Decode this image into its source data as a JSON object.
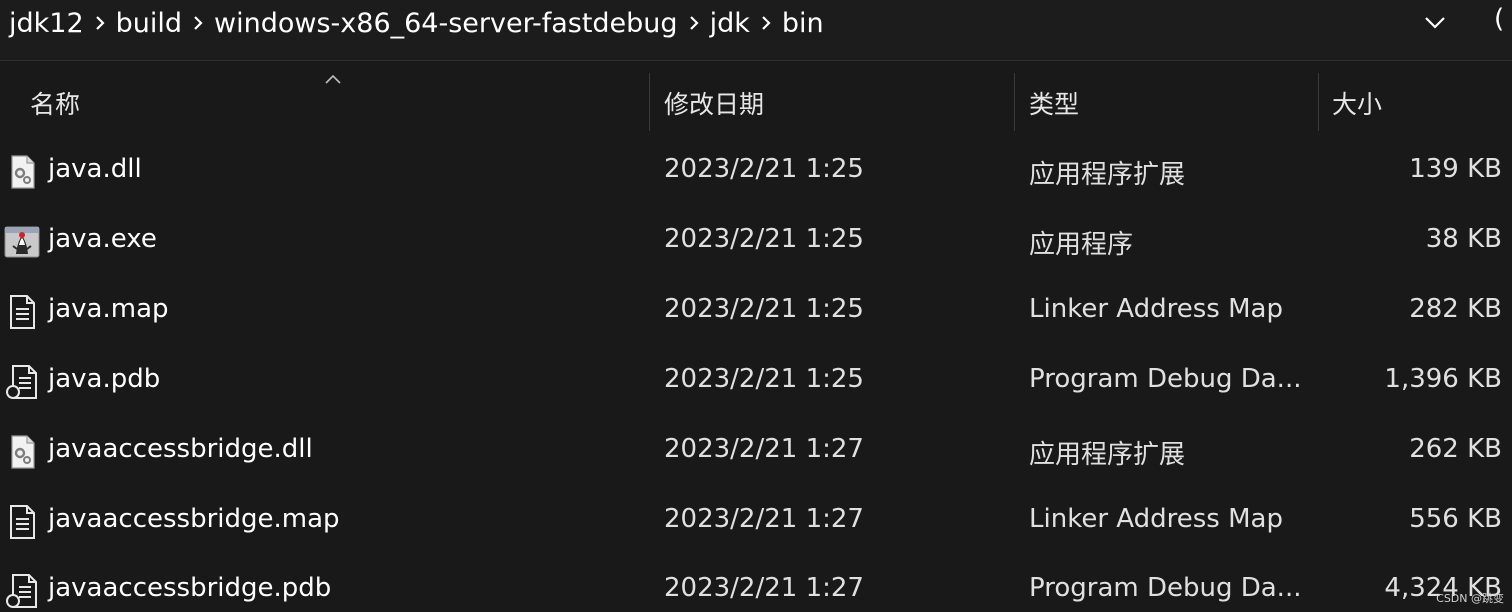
{
  "breadcrumb": {
    "items": [
      "jdk12",
      "build",
      "windows-x86_64-server-fastdebug",
      "jdk",
      "bin"
    ]
  },
  "icons": {
    "separator": "chevron-right-icon",
    "dropdown": "chevron-down-icon",
    "sort": "sort-ascending-icon"
  },
  "columns": {
    "name": "名称",
    "modified": "修改日期",
    "type": "类型",
    "size": "大小"
  },
  "files": [
    {
      "name": "java.dll",
      "modified": "2023/2/21 1:25",
      "type": "应用程序扩展",
      "size": "139 KB",
      "icon": "dll-file-icon"
    },
    {
      "name": "java.exe",
      "modified": "2023/2/21 1:25",
      "type": "应用程序",
      "size": "38 KB",
      "icon": "java-exe-icon"
    },
    {
      "name": "java.map",
      "modified": "2023/2/21 1:25",
      "type": "Linker Address Map",
      "size": "282 KB",
      "icon": "text-file-icon"
    },
    {
      "name": "java.pdb",
      "modified": "2023/2/21 1:25",
      "type": "Program Debug Da...",
      "size": "1,396 KB",
      "icon": "pdb-file-icon"
    },
    {
      "name": "javaaccessbridge.dll",
      "modified": "2023/2/21 1:27",
      "type": "应用程序扩展",
      "size": "262 KB",
      "icon": "dll-file-icon"
    },
    {
      "name": "javaaccessbridge.map",
      "modified": "2023/2/21 1:27",
      "type": "Linker Address Map",
      "size": "556 KB",
      "icon": "text-file-icon"
    },
    {
      "name": "javaaccessbridge.pdb",
      "modified": "2023/2/21 1:27",
      "type": "Program Debug Da...",
      "size": "4,324 KB",
      "icon": "pdb-file-icon"
    }
  ],
  "watermark": "CSDN @跳变",
  "colors": {
    "background": "#191919",
    "text": "#ffffff",
    "separator": "#3a3a3a"
  }
}
